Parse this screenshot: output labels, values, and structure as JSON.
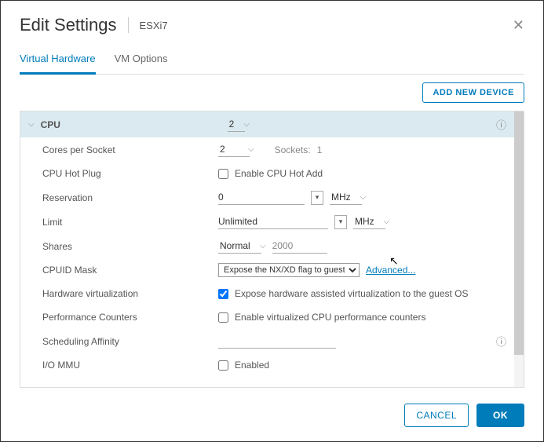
{
  "header": {
    "title": "Edit Settings",
    "subtitle": "ESXi7"
  },
  "tabs": {
    "active": "Virtual Hardware",
    "other": "VM Options"
  },
  "toolbar": {
    "add_device": "ADD NEW DEVICE"
  },
  "accordion": {
    "cpu_label": "CPU",
    "cpu_value": "2"
  },
  "rows": {
    "cores_per_socket": {
      "label": "Cores per Socket",
      "value": "2",
      "sockets_label": "Sockets:",
      "sockets_value": "1"
    },
    "hot_plug": {
      "label": "CPU Hot Plug",
      "checkbox_label": "Enable CPU Hot Add",
      "checked": false
    },
    "reservation": {
      "label": "Reservation",
      "value": "0",
      "unit": "MHz"
    },
    "limit": {
      "label": "Limit",
      "value": "Unlimited",
      "unit": "MHz"
    },
    "shares": {
      "label": "Shares",
      "mode": "Normal",
      "value": "2000"
    },
    "cpuid_mask": {
      "label": "CPUID Mask",
      "selected": "Expose the NX/XD flag to guest",
      "link": "Advanced..."
    },
    "hw_virt": {
      "label": "Hardware virtualization",
      "checkbox_label": "Expose hardware assisted virtualization to the guest OS",
      "checked": true
    },
    "perf_counters": {
      "label": "Performance Counters",
      "checkbox_label": "Enable virtualized CPU performance counters",
      "checked": false
    },
    "sched_affinity": {
      "label": "Scheduling Affinity",
      "value": ""
    },
    "io_mmu": {
      "label": "I/O MMU",
      "checkbox_label": "Enabled",
      "checked": false
    }
  },
  "footer": {
    "cancel": "CANCEL",
    "ok": "OK"
  }
}
